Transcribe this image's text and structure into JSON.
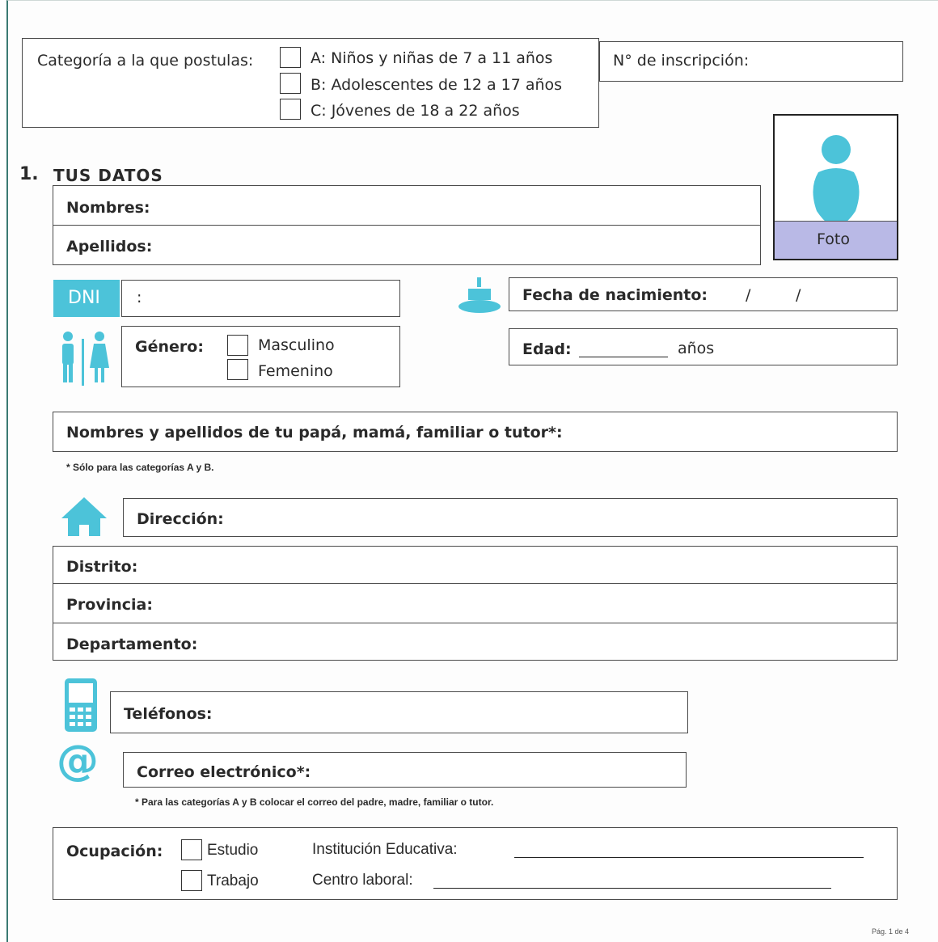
{
  "category": {
    "question": "Categoría a la que postulas:",
    "options": [
      "A: Niños y niñas de 7 a 11 años",
      "B: Adolescentes de 12 a 17 años",
      "C: Jóvenes de 18 a 22 años"
    ]
  },
  "inscription": {
    "label": "N° de inscripción:"
  },
  "section": {
    "number": "1.",
    "title": "TUS DATOS"
  },
  "photo": {
    "label": "Foto"
  },
  "names": {
    "first": "Nombres:",
    "last": "Apellidos:"
  },
  "dni": {
    "badge": "DNI",
    "sep": ":"
  },
  "birth": {
    "label": "Fecha de nacimiento:",
    "sep1": "/",
    "sep2": "/"
  },
  "gender": {
    "label": "Género:",
    "options": [
      "Masculino",
      "Femenino"
    ]
  },
  "age": {
    "label": "Edad:",
    "unit": "años"
  },
  "guardian": {
    "label": "Nombres y apellidos de tu papá, mamá, familiar o tutor*:",
    "note": "* Sólo para las categorías A y B."
  },
  "address": {
    "direccion": "Dirección:",
    "distrito": "Distrito:",
    "provincia": "Provincia:",
    "departamento": "Departamento:"
  },
  "phones": {
    "label": "Teléfonos:"
  },
  "email": {
    "label": "Correo electrónico*:",
    "note": "* Para las categorías A y B colocar el correo del padre, madre, familiar o tutor."
  },
  "occupation": {
    "label": "Ocupación:",
    "options": [
      "Estudio",
      "Trabajo"
    ],
    "institution": "Institución Educativa:",
    "workplace": "Centro laboral:"
  },
  "footer": {
    "page": "Pág. 1 de 4"
  },
  "colors": {
    "accent": "#4cc3d9",
    "photo_band": "#b9b9e6"
  }
}
